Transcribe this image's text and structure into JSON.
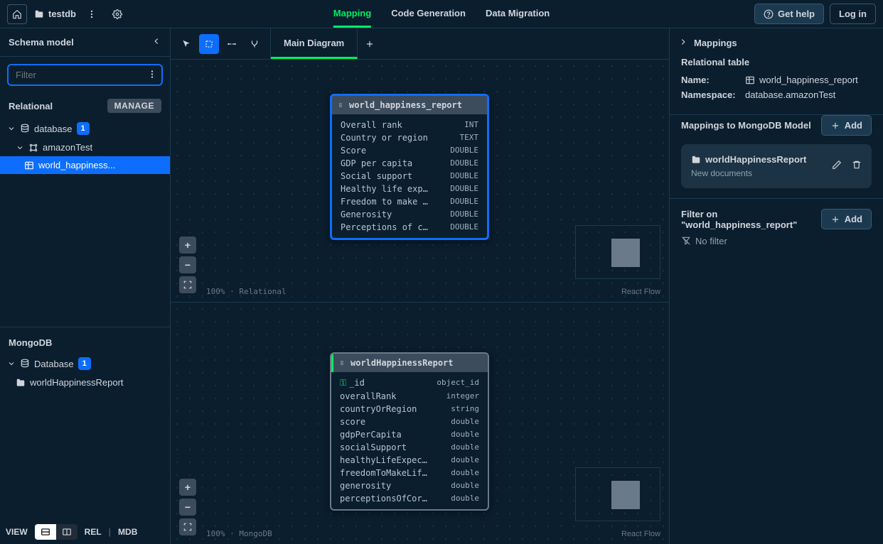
{
  "header": {
    "project_name": "testdb",
    "tabs": [
      "Mapping",
      "Code Generation",
      "Data Migration"
    ],
    "get_help": "Get help",
    "log_in": "Log in"
  },
  "left": {
    "title": "Schema model",
    "filter_placeholder": "Filter",
    "relational": {
      "label": "Relational",
      "manage": "MANAGE",
      "items": {
        "database": {
          "label": "database",
          "badge": "1"
        },
        "schema": {
          "label": "amazonTest"
        },
        "table": {
          "label": "world_happiness..."
        }
      }
    },
    "mongodb": {
      "label": "MongoDB",
      "database": {
        "label": "Database",
        "badge": "1"
      },
      "collection": {
        "label": "worldHappinessReport"
      }
    },
    "bottom": {
      "view": "VIEW",
      "rel": "REL",
      "mdb": "MDB"
    }
  },
  "canvas": {
    "main_tab": "Main Diagram",
    "zoom_top": "100%",
    "mode_top": "Relational",
    "zoom_bottom": "100%",
    "mode_bottom": "MongoDB",
    "react_flow": "React Flow",
    "relational_entity": {
      "name": "world_happiness_report",
      "rows": [
        {
          "name": "Overall rank",
          "type": "INT"
        },
        {
          "name": "Country or region",
          "type": "TEXT"
        },
        {
          "name": "Score",
          "type": "DOUBLE"
        },
        {
          "name": "GDP per capita",
          "type": "DOUBLE"
        },
        {
          "name": "Social support",
          "type": "DOUBLE"
        },
        {
          "name": "Healthy life exp…",
          "type": "DOUBLE"
        },
        {
          "name": "Freedom to make …",
          "type": "DOUBLE"
        },
        {
          "name": "Generosity",
          "type": "DOUBLE"
        },
        {
          "name": "Perceptions of c…",
          "type": "DOUBLE"
        }
      ]
    },
    "mongo_entity": {
      "name": "worldHappinessReport",
      "rows": [
        {
          "name": "_id",
          "type": "object_id",
          "key": true
        },
        {
          "name": "overallRank",
          "type": "integer"
        },
        {
          "name": "countryOrRegion",
          "type": "string"
        },
        {
          "name": "score",
          "type": "double"
        },
        {
          "name": "gdpPerCapita",
          "type": "double"
        },
        {
          "name": "socialSupport",
          "type": "double"
        },
        {
          "name": "healthyLifeExpec…",
          "type": "double"
        },
        {
          "name": "freedomToMakeLif…",
          "type": "double"
        },
        {
          "name": "generosity",
          "type": "double"
        },
        {
          "name": "perceptionsOfCor…",
          "type": "double"
        }
      ]
    }
  },
  "right": {
    "title": "Mappings",
    "rel_table_heading": "Relational table",
    "name_label": "Name:",
    "name_value": "world_happiness_report",
    "namespace_label": "Namespace:",
    "namespace_value": "database.amazonTest",
    "mappings_heading": "Mappings to MongoDB Model",
    "add": "Add",
    "mapping_card": {
      "title": "worldHappinessReport",
      "subtitle": "New documents"
    },
    "filter_heading": "Filter on \"world_happiness_report\"",
    "no_filter": "No filter"
  }
}
